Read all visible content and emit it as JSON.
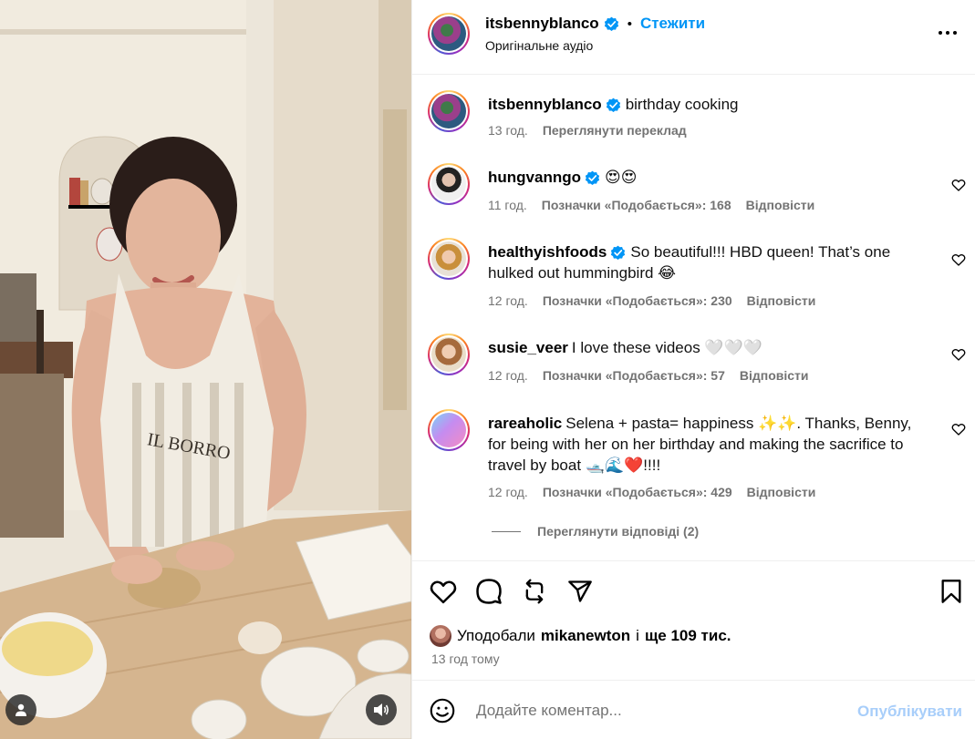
{
  "post": {
    "author": "itsbennyblanco",
    "follow_label": "Стежити",
    "audio_label": "Оригінальне аудіо",
    "dot": "•",
    "verified_color": "#0095f6",
    "accent_color": "#0095f6"
  },
  "caption": {
    "username": "itsbennyblanco",
    "text": "birthday cooking",
    "time": "13 год.",
    "translate_label": "Переглянути переклад"
  },
  "comments": [
    {
      "username": "hungvanngo",
      "verified": true,
      "text": "😍😍",
      "time": "11 год.",
      "likes": "Позначки «Подобається»: 168",
      "reply_label": "Відповісти"
    },
    {
      "username": "healthyishfoods",
      "verified": true,
      "text": "So beautiful!!! HBD queen! That’s one hulked out hummingbird 😂",
      "time": "12 год.",
      "likes": "Позначки «Подобається»: 230",
      "reply_label": "Відповісти"
    },
    {
      "username": "susie_veer",
      "verified": false,
      "text": "I love these videos 🤍🤍🤍",
      "time": "12 год.",
      "likes": "Позначки «Подобається»: 57",
      "reply_label": "Відповісти"
    },
    {
      "username": "rareaholic",
      "verified": false,
      "text": "Selena + pasta= happiness ✨✨. Thanks, Benny, for being with her on her birthday and making the sacrifice to travel by boat 🛥️🌊❤️!!!!",
      "time": "12 год.",
      "likes": "Позначки «Подобається»: 429",
      "reply_label": "Відповісти"
    }
  ],
  "view_replies_label": "Переглянути відповіді (2)",
  "likes": {
    "prefix": "Уподобали",
    "user": "mikanewton",
    "middle": "і",
    "count": "ще 109 тис."
  },
  "time_ago": "13 год тому",
  "comment_box": {
    "placeholder": "Додайте коментар...",
    "publish_label": "Опублікувати"
  },
  "icons": {
    "header_more": "more-horizontal-icon",
    "like": "heart-icon",
    "comment": "comment-bubble-icon",
    "repost": "repost-icon",
    "share": "paper-plane-icon",
    "save": "bookmark-icon",
    "emoji": "smiley-icon",
    "user_tag": "user-icon",
    "audio": "speaker-icon"
  },
  "colors": {
    "muted_text": "#737373",
    "publish_disabled": "#a8cefa",
    "divider": "#efefef"
  }
}
